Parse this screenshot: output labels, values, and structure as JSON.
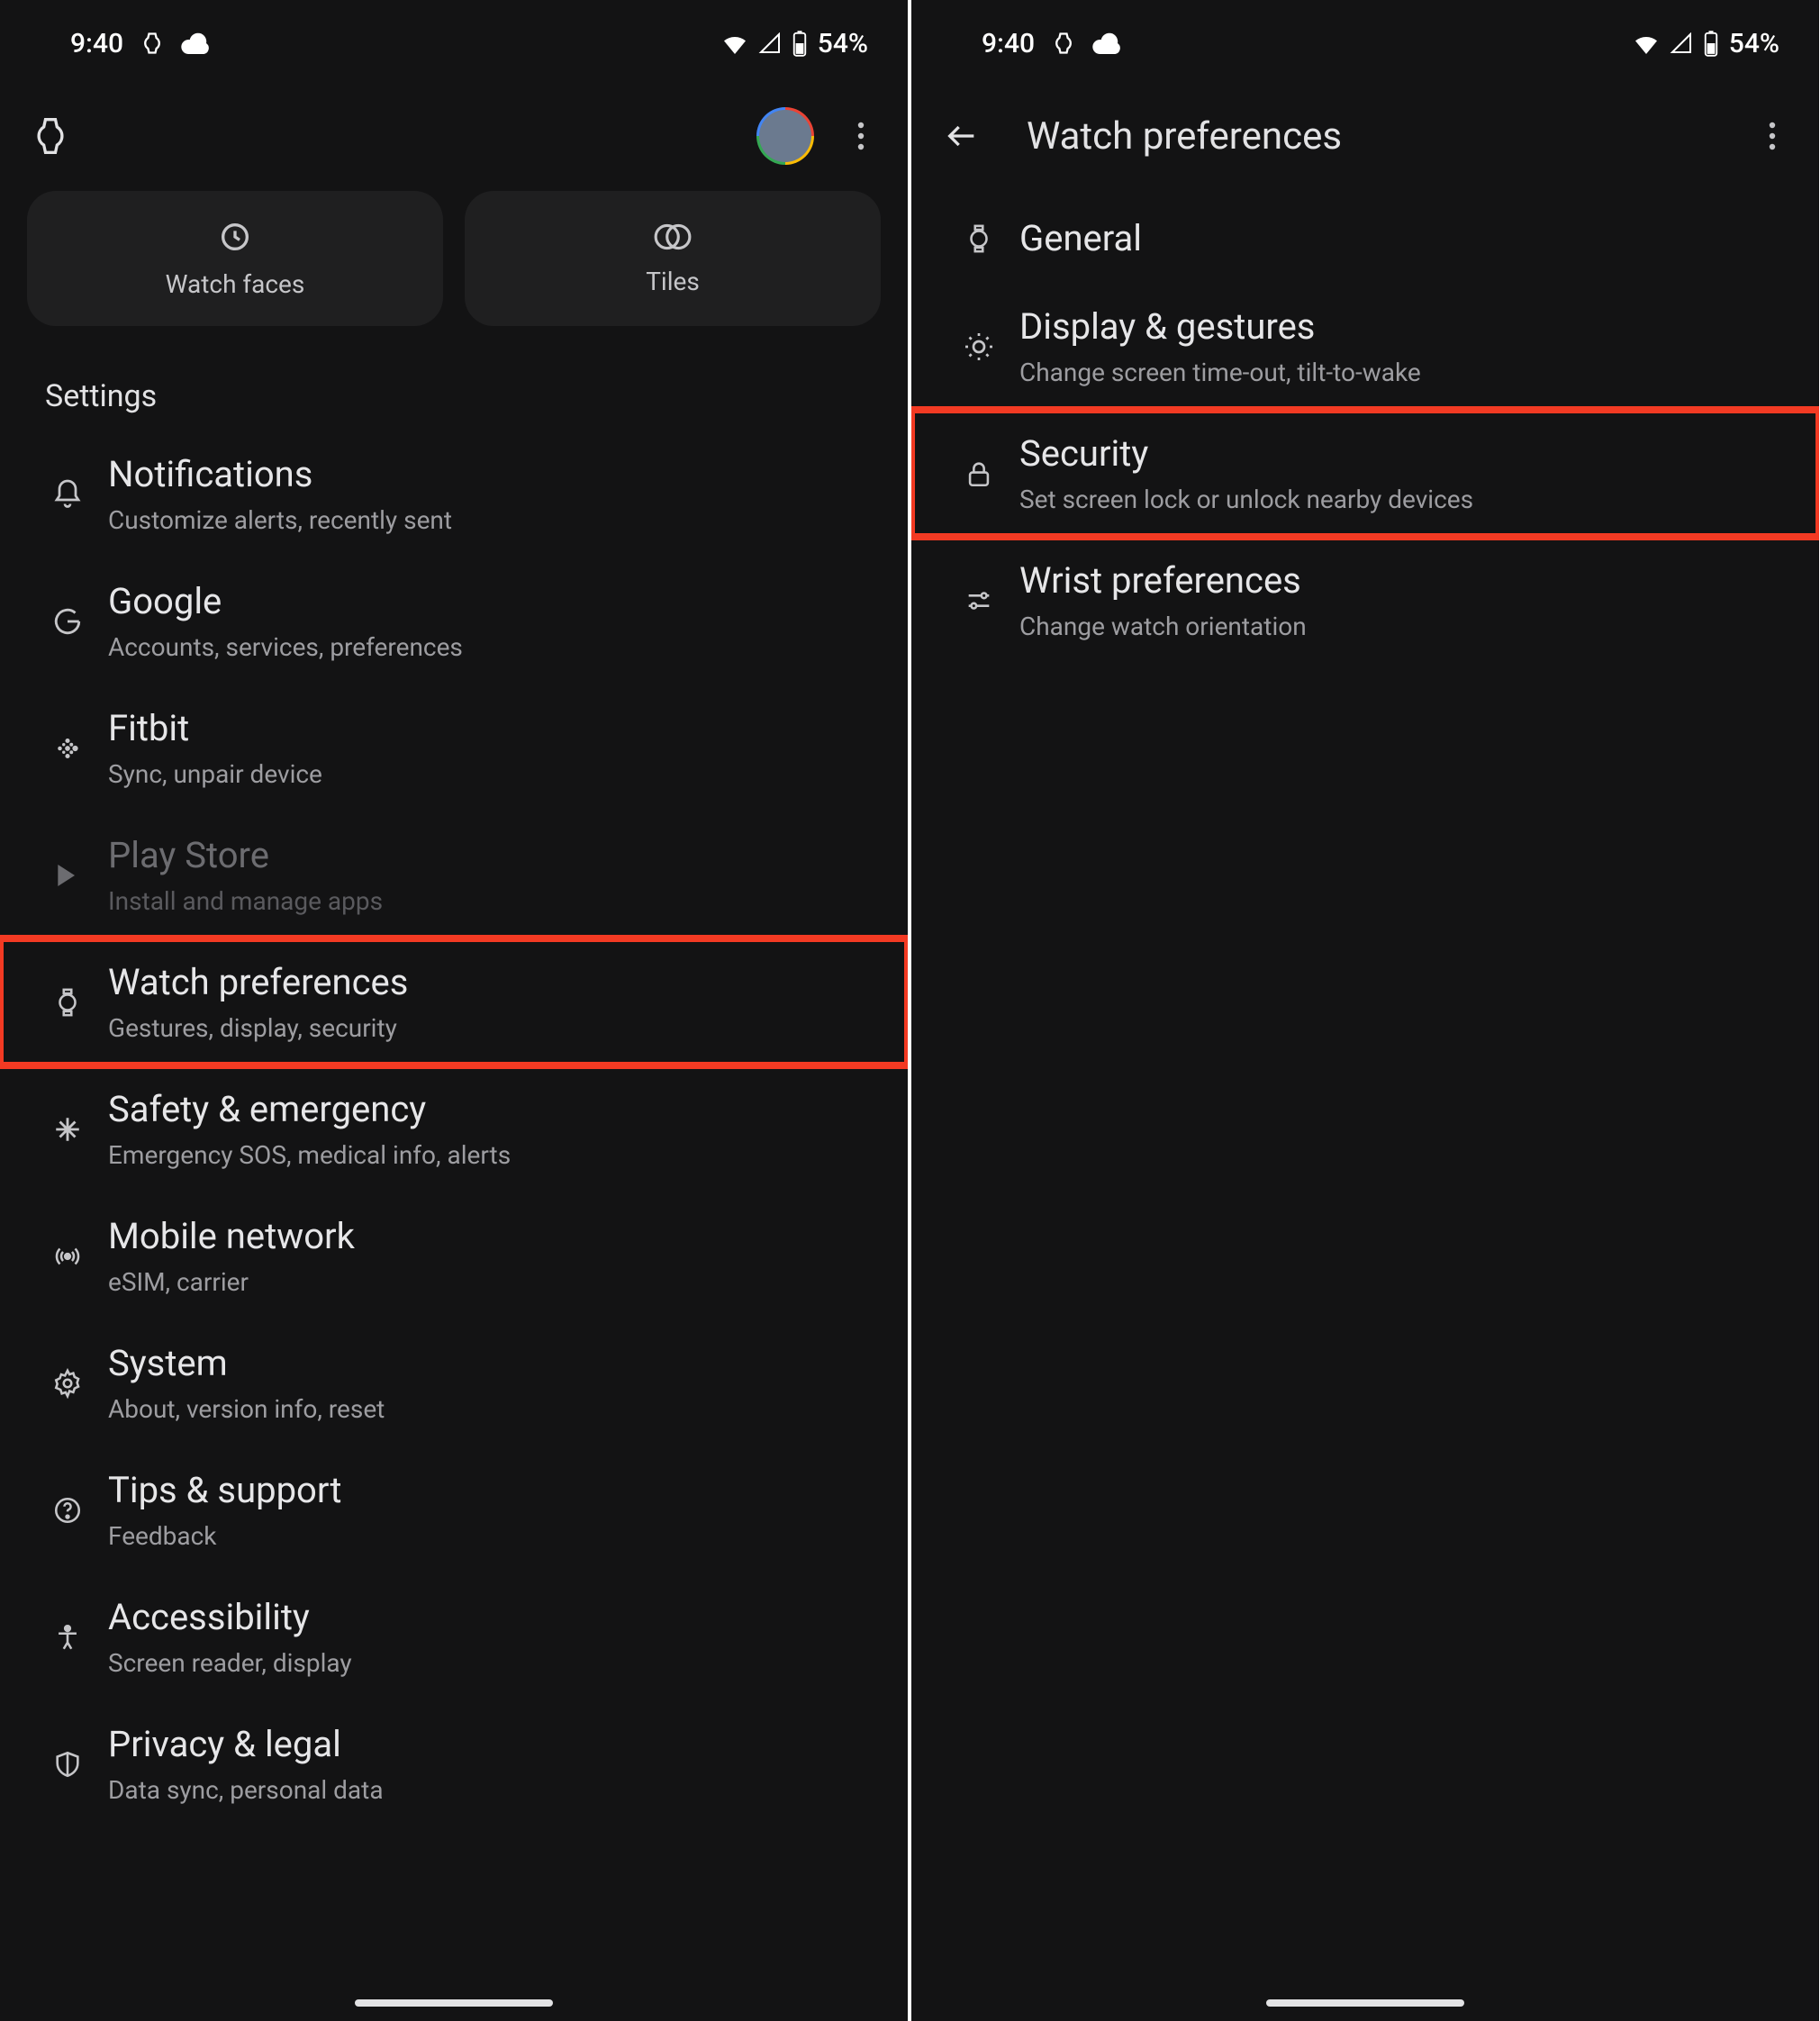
{
  "status": {
    "time": "9:40",
    "battery": "54%"
  },
  "left": {
    "tabs": {
      "watch_faces": "Watch faces",
      "tiles": "Tiles"
    },
    "section_header": "Settings",
    "items": [
      {
        "title": "Notifications",
        "sub": "Customize alerts, recently sent"
      },
      {
        "title": "Google",
        "sub": "Accounts, services, preferences"
      },
      {
        "title": "Fitbit",
        "sub": "Sync, unpair device"
      },
      {
        "title": "Play Store",
        "sub": "Install and manage apps"
      },
      {
        "title": "Watch preferences",
        "sub": "Gestures, display, security"
      },
      {
        "title": "Safety & emergency",
        "sub": "Emergency SOS, medical info, alerts"
      },
      {
        "title": "Mobile network",
        "sub": "eSIM, carrier"
      },
      {
        "title": "System",
        "sub": "About, version info, reset"
      },
      {
        "title": "Tips & support",
        "sub": "Feedback"
      },
      {
        "title": "Accessibility",
        "sub": "Screen reader, display"
      },
      {
        "title": "Privacy & legal",
        "sub": "Data sync, personal data"
      }
    ]
  },
  "right": {
    "title": "Watch preferences",
    "items": [
      {
        "title": "General",
        "sub": ""
      },
      {
        "title": "Display & gestures",
        "sub": "Change screen time-out, tilt-to-wake"
      },
      {
        "title": "Security",
        "sub": "Set screen lock or unlock nearby devices"
      },
      {
        "title": "Wrist preferences",
        "sub": "Change watch orientation"
      }
    ]
  }
}
